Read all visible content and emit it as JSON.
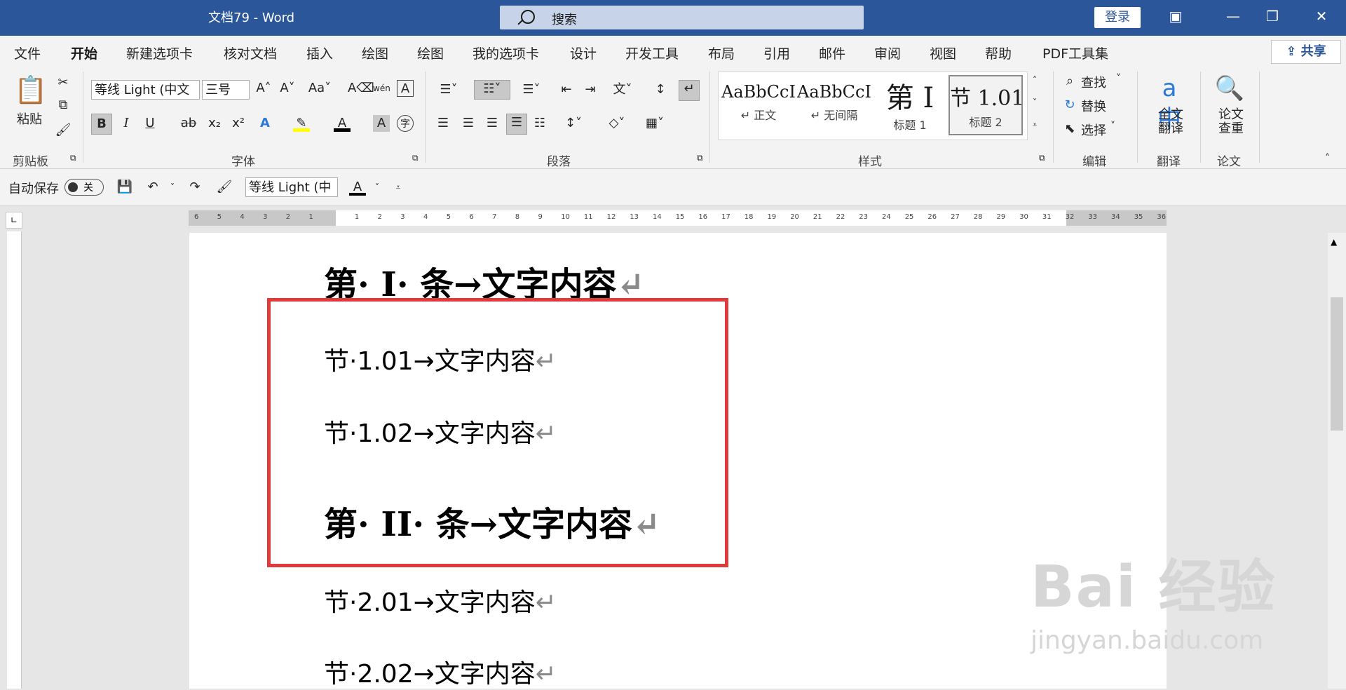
{
  "titlebar": {
    "doc_title": "文档79  -  Word",
    "search_label": "搜索",
    "login": "登录"
  },
  "tabs": [
    "文件",
    "开始",
    "新建选项卡",
    "核对文档",
    "插入",
    "绘图",
    "绘图",
    "我的选项卡",
    "设计",
    "开发工具",
    "布局",
    "引用",
    "邮件",
    "审阅",
    "视图",
    "帮助",
    "PDF工具集"
  ],
  "share": "共享",
  "ribbon": {
    "clipboard": {
      "paste": "粘贴",
      "label": "剪贴板"
    },
    "font": {
      "name": "等线 Light (中文",
      "size": "三号",
      "label": "字体",
      "bold": "B",
      "italic": "I",
      "underline": "U",
      "strike": "ab",
      "sub": "x₂",
      "sup": "x²"
    },
    "paragraph": {
      "label": "段落"
    },
    "styles": {
      "label": "样式",
      "items": [
        {
          "sample": "AaBbCcI",
          "name": "↵ 正文"
        },
        {
          "sample": "AaBbCcI",
          "name": "↵ 无间隔"
        },
        {
          "sample": "第 I",
          "name": "标题 1"
        },
        {
          "sample": "节 1.01",
          "name": "标题 2"
        }
      ]
    },
    "editing": {
      "find": "查找",
      "replace": "替换",
      "select": "选择",
      "label": "编辑"
    },
    "translate": {
      "btn": "全文翻译",
      "label": "翻译"
    },
    "paper": {
      "btn": "论文查重",
      "label": "论文"
    }
  },
  "qat": {
    "autosave": "自动保存",
    "toggle": "关",
    "font": "等线 Light (中"
  },
  "doc": {
    "lines": [
      {
        "text": "第· I· 条→文字内容",
        "mark": "↵",
        "style": "h1"
      },
      {
        "text": "节·1.01→文字内容",
        "mark": "↵",
        "style": "h2"
      },
      {
        "text": "节·1.02→文字内容",
        "mark": "↵",
        "style": "h2"
      },
      {
        "text": "第· II· 条→文字内容",
        "mark": "↵",
        "style": "h1"
      },
      {
        "text": "节·2.01→文字内容",
        "mark": "↵",
        "style": "h2"
      },
      {
        "text": "节·2.02→文字内容",
        "mark": "↵",
        "style": "h2"
      }
    ]
  },
  "watermark": {
    "brand": "Bai 经验",
    "url": "jingyan.baidu.com"
  },
  "ruler_numbers": [
    "6",
    "5",
    "4",
    "3",
    "2",
    "1",
    "",
    "1",
    "2",
    "3",
    "4",
    "5",
    "6",
    "7",
    "8",
    "9",
    "10",
    "11",
    "12",
    "13",
    "14",
    "15",
    "16",
    "17",
    "18",
    "19",
    "20",
    "21",
    "22",
    "23",
    "24",
    "25",
    "26",
    "27",
    "28",
    "29",
    "30",
    "31",
    "32",
    "33",
    "34",
    "35",
    "36"
  ]
}
